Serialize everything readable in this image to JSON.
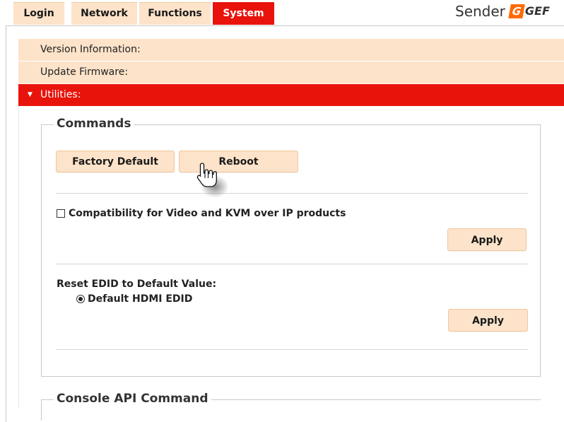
{
  "tabs": [
    {
      "label": "Login",
      "active": false
    },
    {
      "label": "Network",
      "active": false
    },
    {
      "label": "Functions",
      "active": false
    },
    {
      "label": "System",
      "active": true
    }
  ],
  "brand": {
    "device_label": "Sender",
    "logo_mark": "G",
    "logo_text": "GEF"
  },
  "accordion": {
    "version_information": "Version Information:",
    "update_firmware": "Update Firmware:",
    "utilities": "Utilities:"
  },
  "commands": {
    "legend": "Commands",
    "factory_default_label": "Factory Default",
    "reboot_label": "Reboot",
    "compatibility_label": "Compatibility for Video and KVM over IP products",
    "compatibility_checked": false,
    "apply_label_1": "Apply",
    "reset_edid_label": "Reset EDID to Default Value:",
    "edid_option_label": "Default HDMI EDID",
    "edid_option_selected": true,
    "apply_label_2": "Apply"
  },
  "console": {
    "legend": "Console API Command"
  },
  "colors": {
    "accent_red": "#e8140c",
    "peach": "#fde3c9",
    "logo_orange": "#ff6a00"
  },
  "icons": {
    "cursor": "hand-pointer-icon",
    "expand": "triangle-down-icon",
    "collapsed": "triangle-right-icon"
  }
}
